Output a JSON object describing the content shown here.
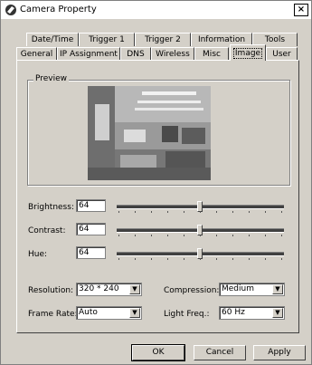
{
  "window": {
    "title": "Camera Property",
    "close_label": "×"
  },
  "tabs_back": [
    {
      "label": "Date/Time"
    },
    {
      "label": "Trigger 1"
    },
    {
      "label": "Trigger 2"
    },
    {
      "label": "Information"
    },
    {
      "label": "Tools"
    }
  ],
  "tabs_front": [
    {
      "label": "General"
    },
    {
      "label": "IP Assignment"
    },
    {
      "label": "DNS"
    },
    {
      "label": "Wireless"
    },
    {
      "label": "Misc"
    },
    {
      "label": "Image"
    },
    {
      "label": "User"
    }
  ],
  "active_tab": "Image",
  "preview": {
    "label": "Preview"
  },
  "sliders": {
    "brightness": {
      "label": "Brightness:",
      "value": "64",
      "position": 0.5
    },
    "contrast": {
      "label": "Contrast:",
      "value": "64",
      "position": 0.5
    },
    "hue": {
      "label": "Hue:",
      "value": "64",
      "position": 0.5
    }
  },
  "selects": {
    "resolution": {
      "label": "Resolution:",
      "value": "320 * 240"
    },
    "compression": {
      "label": "Compression:",
      "value": "Medium"
    },
    "frame_rate": {
      "label": "Frame Rate:",
      "value": "Auto"
    },
    "light_freq": {
      "label": "Light Freq.:",
      "value": "60 Hz"
    }
  },
  "buttons": {
    "ok": "OK",
    "cancel": "Cancel",
    "apply": "Apply"
  },
  "icons": {
    "app": "camera-icon",
    "dropdown": "chevron-down-icon"
  }
}
